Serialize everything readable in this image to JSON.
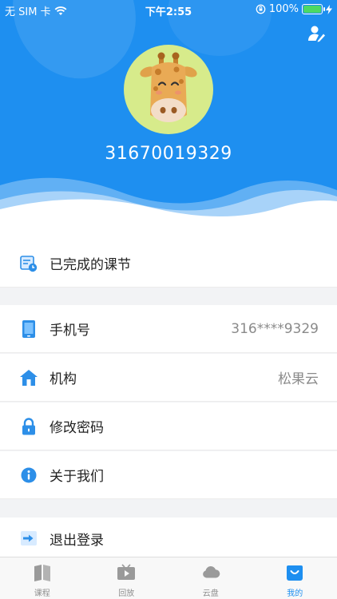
{
  "status_bar": {
    "carrier": "无 SIM 卡",
    "time": "下午2:55",
    "battery": "100%"
  },
  "profile": {
    "phone": "31670019329"
  },
  "menu": {
    "completed_lessons": "已完成的课节",
    "phone_label": "手机号",
    "phone_value": "316****9329",
    "org_label": "机构",
    "org_value": "松果云",
    "change_password": "修改密码",
    "about_us": "关于我们",
    "logout": "退出登录"
  },
  "tabs": [
    {
      "label": "课程",
      "icon": "book-icon",
      "active": false
    },
    {
      "label": "回放",
      "icon": "play-icon",
      "active": false
    },
    {
      "label": "云盘",
      "icon": "cloud-icon",
      "active": false
    },
    {
      "label": "我的",
      "icon": "person-icon",
      "active": true
    }
  ],
  "colors": {
    "accent": "#1e8ff0",
    "tab_inactive": "#8e8e8e"
  }
}
